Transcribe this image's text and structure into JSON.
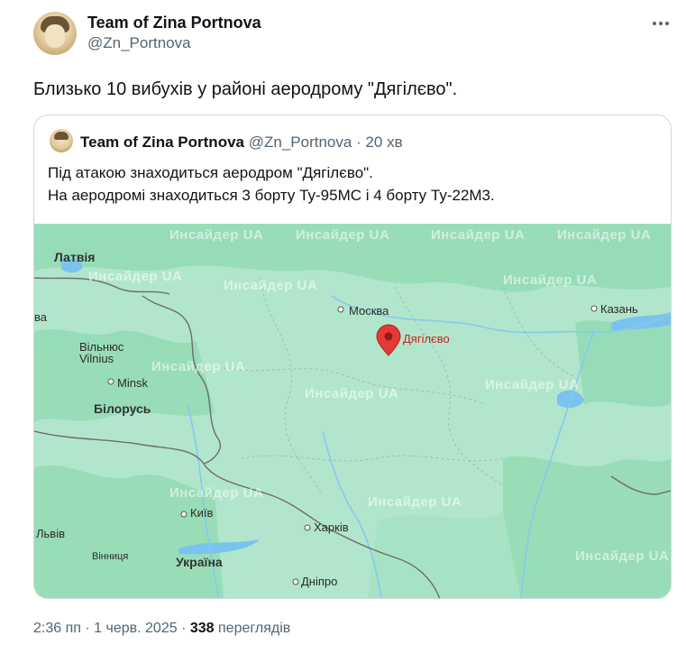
{
  "author": {
    "name": "Team of Zina Portnova",
    "handle": "@Zn_Portnova"
  },
  "tweet_text": "Близько 10 вибухів у районі аеродрому \"Дягілєво\".",
  "quote": {
    "name": "Team of Zina Portnova",
    "handle": "@Zn_Portnova",
    "separator": "·",
    "time": "20 хв",
    "line1": "Під атакою знаходиться аеродром \"Дягілєво\".",
    "line2": "На аеродромі знаходиться 3 борту Ту-95МС і 4 борту Ту-22М3."
  },
  "map": {
    "marker_label": "Дягілєво",
    "marker_color": "#e53935",
    "places": {
      "latvia": "Латвія",
      "moscow": "Москва",
      "kazan": "Казань",
      "vilnius_uk": "Вільнюс",
      "vilnius": "Vilnius",
      "minsk": "Minsk",
      "belarus": "Білорусь",
      "kyiv": "Київ",
      "kharkiv": "Харків",
      "lviv": "Львів",
      "vinnytsia": "Вінниця",
      "ukraine": "Україна",
      "dnipro": "Дніпро",
      "edge_ba": "ва"
    },
    "watermark": "Инсайдер UA"
  },
  "footer": {
    "time": "2:36 пп",
    "dot1": "·",
    "date": "1 черв. 2025",
    "dot2": "·",
    "views": "338",
    "views_label": "переглядів"
  },
  "colors": {
    "map_land": "#b2e6cc",
    "map_forest": "#8fd8b3",
    "water": "#7ac3ee",
    "border": "#6d6d6d"
  }
}
